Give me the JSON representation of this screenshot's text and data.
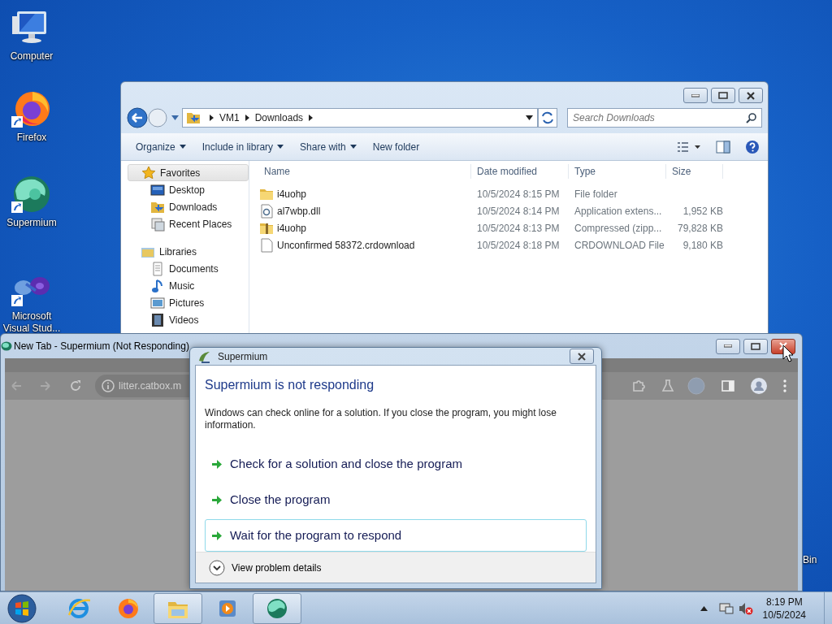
{
  "desktop_icons": [
    {
      "label": "Computer",
      "kind": "computer",
      "shortcut": false
    },
    {
      "label": "Firefox",
      "kind": "firefox",
      "shortcut": true
    },
    {
      "label": "Supermium",
      "kind": "supermium",
      "shortcut": true
    },
    {
      "label": "Microsoft Visual Stud...",
      "kind": "vs",
      "shortcut": true
    }
  ],
  "partial_desktop_label": "Bin",
  "explorer": {
    "breadcrumb": [
      "VM1",
      "Downloads"
    ],
    "search": {
      "placeholder": "Search Downloads"
    },
    "commands": [
      {
        "label": "Organize",
        "dropdown": true
      },
      {
        "label": "Include in library",
        "dropdown": true
      },
      {
        "label": "Share with",
        "dropdown": true
      },
      {
        "label": "New folder",
        "dropdown": false
      }
    ],
    "nav": [
      {
        "label": "Favorites",
        "kind": "star",
        "selected": true,
        "children": [
          {
            "label": "Desktop",
            "kind": "desktop",
            "selected": false
          },
          {
            "label": "Downloads",
            "kind": "downloads",
            "selected": false
          },
          {
            "label": "Recent Places",
            "kind": "recent",
            "selected": false
          }
        ]
      },
      {
        "label": "Libraries",
        "kind": "library",
        "selected": false,
        "children": [
          {
            "label": "Documents",
            "kind": "documents",
            "selected": false
          },
          {
            "label": "Music",
            "kind": "music",
            "selected": false
          },
          {
            "label": "Pictures",
            "kind": "pictures",
            "selected": false
          },
          {
            "label": "Videos",
            "kind": "videos",
            "selected": false
          }
        ]
      }
    ],
    "columns": [
      "Name",
      "Date modified",
      "Type",
      "Size"
    ],
    "files": [
      {
        "name": "i4uohp",
        "date": "10/5/2024 8:15 PM",
        "type": "File folder",
        "kind": "folder"
      },
      {
        "name": "al7wbp.dll",
        "date": "10/5/2024 8:14 PM",
        "type": "Application extens...",
        "size": "1,952 KB",
        "kind": "dll"
      },
      {
        "name": "i4uohp",
        "date": "10/5/2024 8:13 PM",
        "type": "Compressed (zipp...",
        "size": "79,828 KB",
        "kind": "zip"
      },
      {
        "name": "Unconfirmed 58372.crdownload",
        "date": "10/5/2024 8:18 PM",
        "type": "CRDOWNLOAD File",
        "size": "9,180 KB",
        "kind": "file"
      }
    ]
  },
  "browser": {
    "title": "New Tab - Supermium (Not Responding)",
    "address": "litter.catbox.m"
  },
  "dialog": {
    "title": "Supermium",
    "heading": "Supermium is not responding",
    "message": "Windows can check online for a solution. If you close the program, you might lose information.",
    "options": [
      {
        "label": "Check for a solution and close the program",
        "selected": false
      },
      {
        "label": "Close the program",
        "selected": false
      },
      {
        "label": "Wait for the program to respond",
        "selected": true
      }
    ],
    "details": "View problem details"
  },
  "taskbar": {
    "apps": [
      {
        "kind": "ie",
        "open": false
      },
      {
        "kind": "firefox",
        "open": false
      },
      {
        "kind": "explorer",
        "open": true
      },
      {
        "kind": "media",
        "open": false
      },
      {
        "kind": "supermium",
        "open": true
      }
    ],
    "clock": {
      "time": "8:19 PM",
      "date": "10/5/2024"
    }
  }
}
